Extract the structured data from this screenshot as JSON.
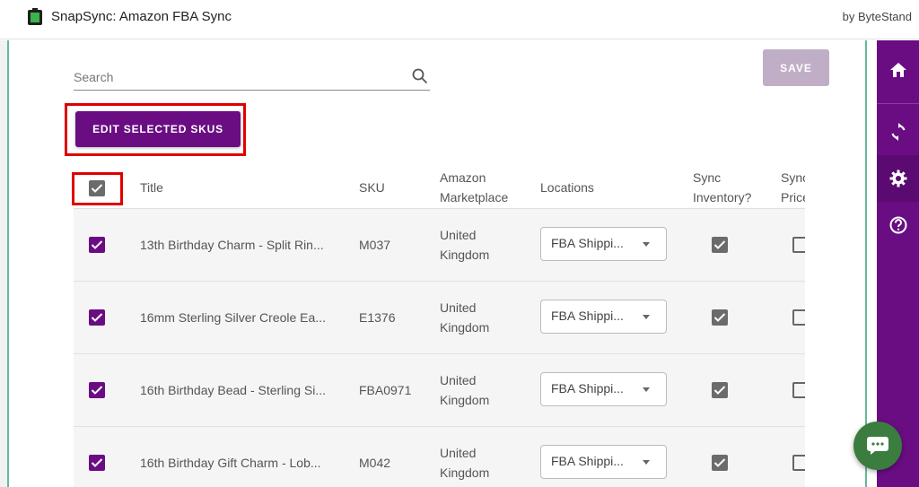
{
  "app": {
    "title": "SnapSync: Amazon FBA Sync",
    "byline": "by ByteStand"
  },
  "search": {
    "placeholder": "Search"
  },
  "toolbar": {
    "save_label": "SAVE",
    "edit_label": "EDIT SELECTED SKUS"
  },
  "table": {
    "headers": {
      "title": "Title",
      "sku": "SKU",
      "marketplace_1": "Amazon",
      "marketplace_2": "Marketplace",
      "locations": "Locations",
      "sync_inventory_1": "Sync",
      "sync_inventory_2": "Inventory?",
      "sync_price_1": "Sync",
      "sync_price_2": "Price?"
    },
    "rows": [
      {
        "title": "13th Birthday Charm - Split Rin...",
        "sku": "M037",
        "marketplace_1": "United",
        "marketplace_2": "Kingdom",
        "location": "FBA Shippi...",
        "selected": true,
        "sync_inventory": true,
        "sync_price": false
      },
      {
        "title": "16mm Sterling Silver Creole Ea...",
        "sku": "E1376",
        "marketplace_1": "United",
        "marketplace_2": "Kingdom",
        "location": "FBA Shippi...",
        "selected": true,
        "sync_inventory": true,
        "sync_price": false
      },
      {
        "title": "16th Birthday Bead - Sterling Si...",
        "sku": "FBA0971",
        "marketplace_1": "United",
        "marketplace_2": "Kingdom",
        "location": "FBA Shippi...",
        "selected": true,
        "sync_inventory": true,
        "sync_price": false
      },
      {
        "title": "16th Birthday Gift Charm - Lob...",
        "sku": "M042",
        "marketplace_1": "United",
        "marketplace_2": "Kingdom",
        "location": "FBA Shippi...",
        "selected": true,
        "sync_inventory": true,
        "sync_price": false
      }
    ]
  },
  "sidebar": {
    "items": [
      "home-icon",
      "sync-icon",
      "settings-icon",
      "help-icon"
    ],
    "active": "settings-icon"
  },
  "colors": {
    "brand": "#6a0d83",
    "highlight": "#e00000",
    "chat": "#3a7d3e",
    "panel_border": "#66b89c"
  }
}
